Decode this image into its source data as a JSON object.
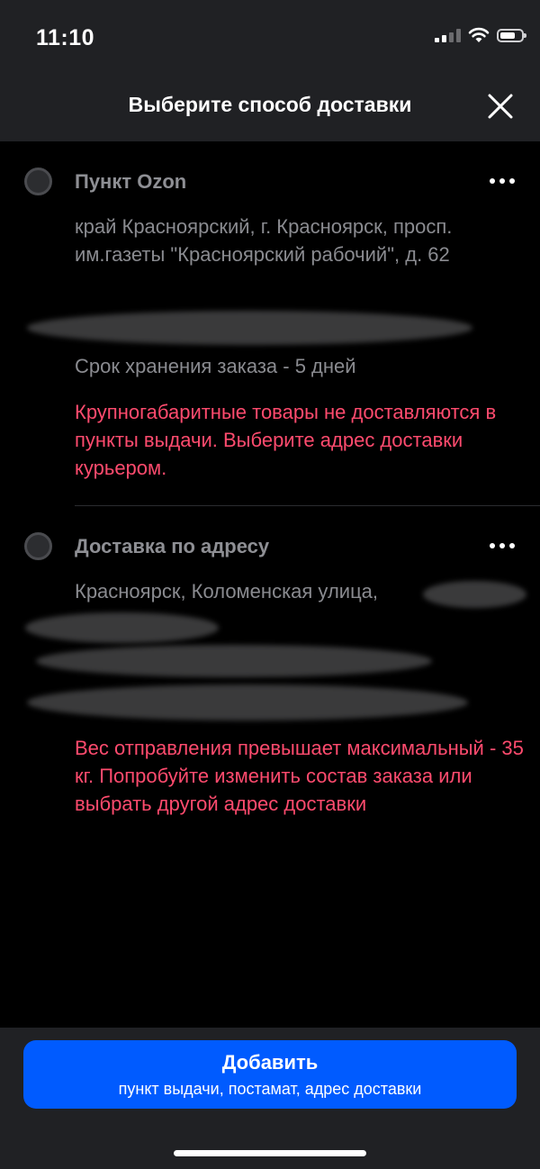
{
  "status_bar": {
    "time": "11:10",
    "icons": [
      "cellular-signal-icon",
      "wifi-icon",
      "battery-icon"
    ]
  },
  "header": {
    "title": "Выберите способ доставки",
    "close_icon": "close-icon"
  },
  "options": [
    {
      "title": "Пункт Ozon",
      "address": "край Красноярский, г. Красноярск, просп. им.газеты \"Красноярский рабочий\", д. 62",
      "storage": "Срок хранения заказа - 5 дней",
      "warning": "Крупногабаритные товары не доставляются в пункты выдачи. Выберите адрес доставки курьером."
    },
    {
      "title": "Доставка по адресу",
      "address": "Красноярск, Коломенская улица,",
      "warning": "Вес отправления превышает максимальный - 35 кг. Попробуйте изменить состав заказа или выбрать другой адрес доставки"
    }
  ],
  "add_button": {
    "label": "Добавить",
    "sublabel": "пункт выдачи, постамат, адрес доставки"
  },
  "colors": {
    "background": "#000000",
    "panel": "#202124",
    "accent": "#005bff",
    "warning": "#ff4b6e",
    "muted_text": "#8a8b90"
  }
}
